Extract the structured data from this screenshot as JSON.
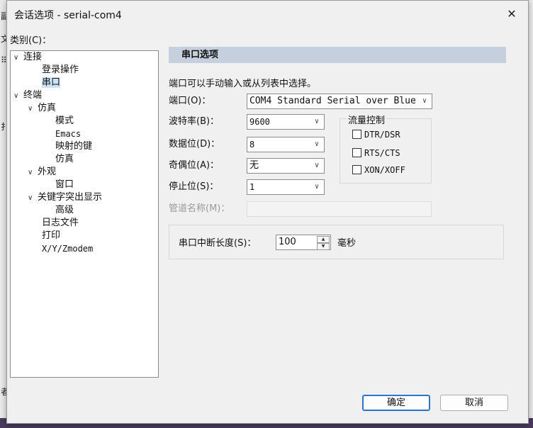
{
  "window": {
    "title": "会话选项 - serial-com4"
  },
  "category": {
    "label": "类别(C)："
  },
  "tree": [
    {
      "label": "连接",
      "expanded": true
    },
    {
      "label": "登录操作"
    },
    {
      "label": "串口",
      "selected": true
    },
    {
      "label": "终端",
      "expanded": true
    },
    {
      "label": "仿真",
      "expanded": true
    },
    {
      "label": "模式"
    },
    {
      "label": "Emacs"
    },
    {
      "label": "映射的键"
    },
    {
      "label": "仿真"
    },
    {
      "label": "外观",
      "expanded": true
    },
    {
      "label": "窗口"
    },
    {
      "label": "关键字突出显示",
      "expanded": true
    },
    {
      "label": "高级"
    },
    {
      "label": "日志文件"
    },
    {
      "label": "打印"
    },
    {
      "label": "X/Y/Zmodem"
    }
  ],
  "pane": {
    "header": "串口选项",
    "description": "端口可以手动输入或从列表中选择。",
    "fields": {
      "port": {
        "label": "端口(O)：",
        "value": "COM4 Standard Serial over Blue"
      },
      "baud": {
        "label": "波特率(B)：",
        "value": "9600"
      },
      "databits": {
        "label": "数据位(D)：",
        "value": "8"
      },
      "parity": {
        "label": "奇偶位(A)：",
        "value": "无"
      },
      "stopbits": {
        "label": "停止位(S)：",
        "value": "1"
      },
      "pipe": {
        "label": "管道名称(M)：",
        "value": ""
      }
    },
    "flow": {
      "title": "流量控制",
      "options": [
        {
          "label": "DTR/DSR",
          "checked": false
        },
        {
          "label": "RTS/CTS",
          "checked": false
        },
        {
          "label": "XON/XOFF",
          "checked": false
        }
      ]
    },
    "break": {
      "label": "串口中断长度(S)：",
      "value": "100",
      "unit": "毫秒"
    }
  },
  "buttons": {
    "ok": "确定",
    "cancel": "取消"
  },
  "background": {
    "left_chars": [
      "副",
      "文",
      "⠿",
      "扌",
      "者"
    ]
  }
}
